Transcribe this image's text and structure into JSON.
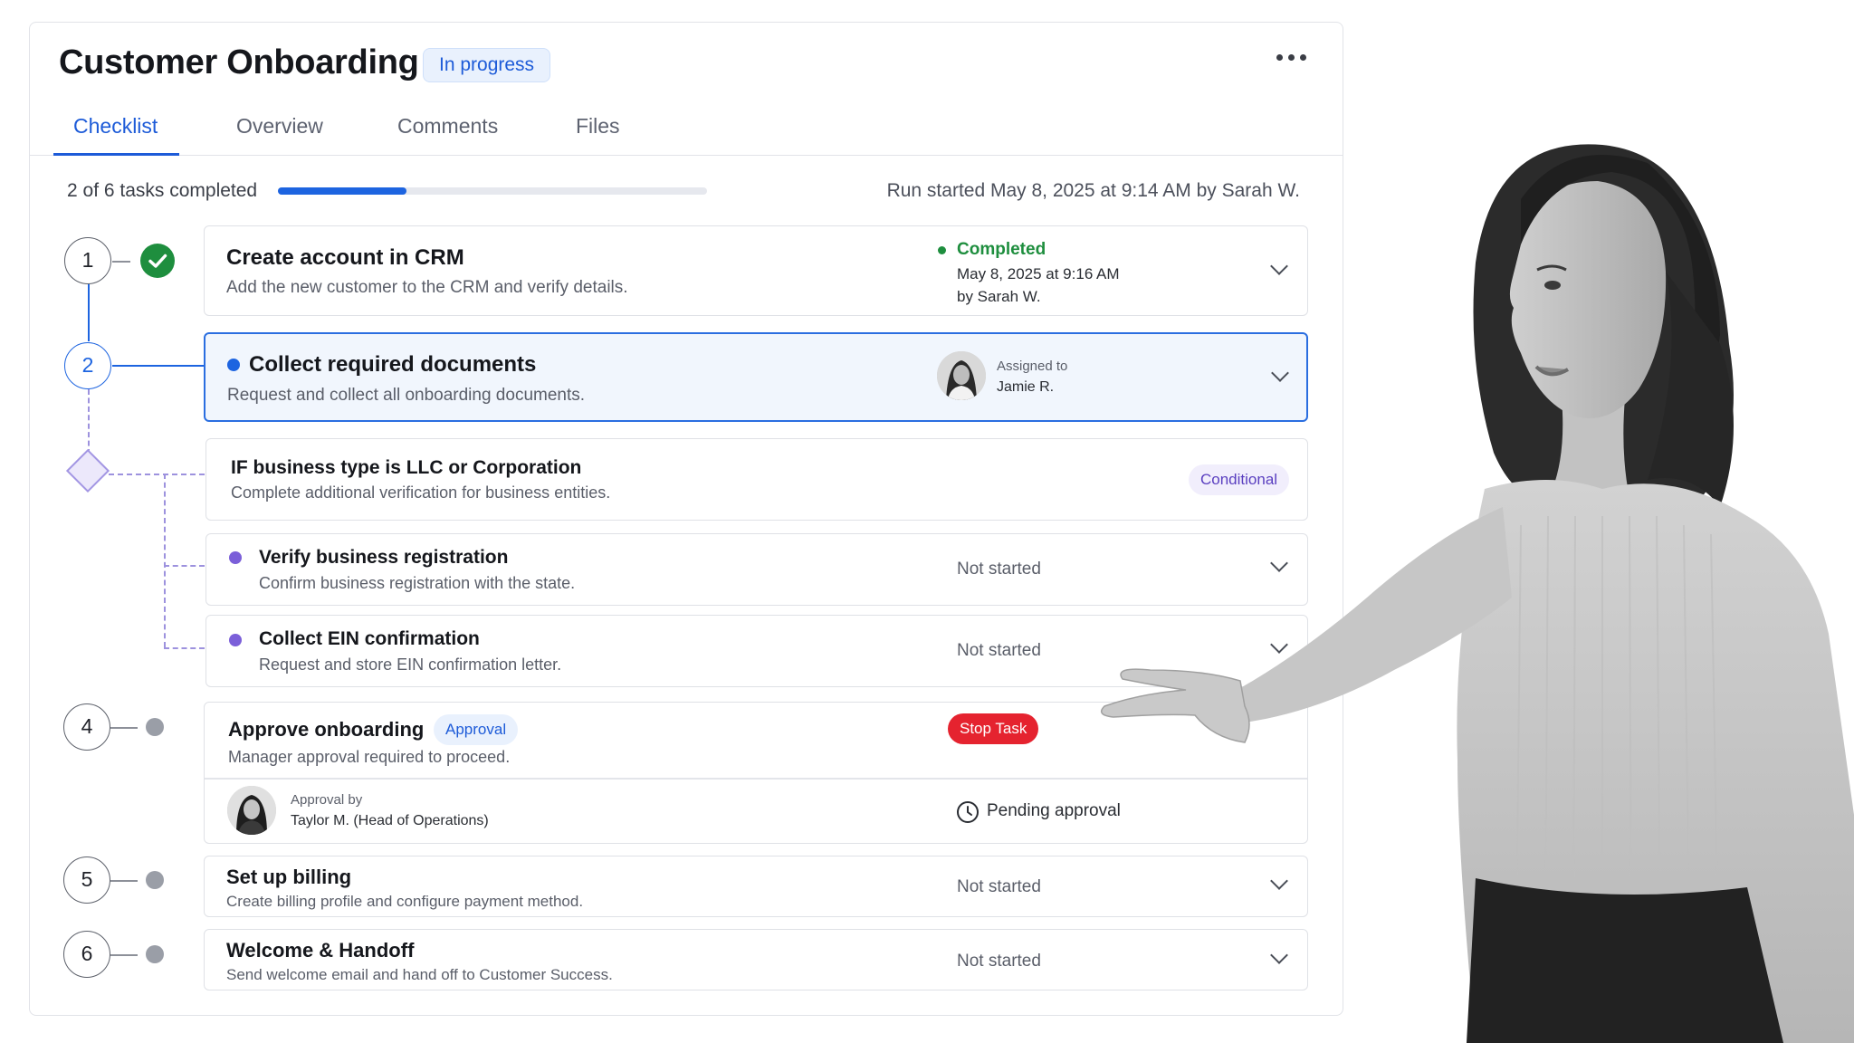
{
  "header": {
    "title": "Customer Onboarding",
    "status": "In progress"
  },
  "tabs": [
    {
      "label": "Checklist",
      "active": true
    },
    {
      "label": "Overview",
      "active": false
    },
    {
      "label": "Comments",
      "active": false
    },
    {
      "label": "Files",
      "active": false
    }
  ],
  "progress": {
    "label": "2 of 6 tasks completed",
    "completed": 2,
    "total": 6,
    "fraction": 0.3
  },
  "run_info": "Run started May 8, 2025 at 9:14 AM by Sarah W.",
  "colors": {
    "accent": "#1d64e0",
    "success": "#1e8e3e",
    "conditional": "#7b5fd9",
    "stop": "#e5232f"
  },
  "tasks": {
    "t1": {
      "number": "1",
      "title": "Create account in CRM",
      "desc": "Add the new customer to the CRM and verify details.",
      "status": "Completed",
      "date": "May 8, 2025 at 9:16 AM",
      "by": "by Sarah W."
    },
    "t2": {
      "number": "2",
      "title": "Collect required documents",
      "desc": "Request and collect all onboarding documents.",
      "assigned_label": "Assigned to",
      "assignee": "Jamie R."
    },
    "cond": {
      "title": "IF business type is LLC or Corporation",
      "desc": "Complete additional verification for business entities.",
      "badge": "Conditional"
    },
    "sub1": {
      "title": "Verify business registration",
      "desc": "Confirm business registration with the state.",
      "status": "Not started"
    },
    "sub2": {
      "title": "Collect EIN confirmation",
      "desc": "Request and store EIN confirmation letter.",
      "status": "Not started"
    },
    "t4": {
      "number": "4",
      "title": "Approve onboarding",
      "badge": "Approval",
      "stop_label": "Stop Task",
      "desc": "Manager approval required to proceed.",
      "approval_label": "Approval by",
      "approver": "Taylor M. (Head of Operations)",
      "approval_status": "Pending approval"
    },
    "t5": {
      "number": "5",
      "title": "Set up billing",
      "desc": "Create billing profile and configure payment method.",
      "status": "Not started"
    },
    "t6": {
      "number": "6",
      "title": "Welcome & Handoff",
      "desc": "Send welcome email and hand off to Customer Success.",
      "status": "Not started"
    }
  }
}
